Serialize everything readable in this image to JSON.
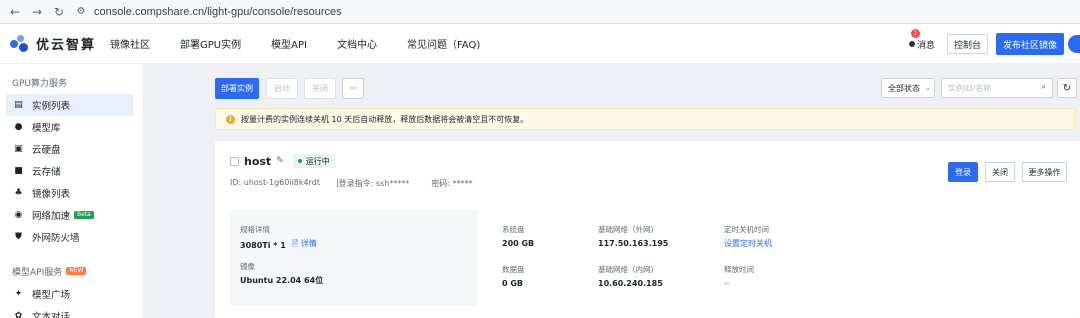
{
  "browser": {
    "url": "console.compshare.cn/light-gpu/console/resources"
  },
  "header": {
    "brand": "优云智算",
    "nav": [
      "镜像社区",
      "部署GPU实例",
      "模型API",
      "文档中心",
      "常见问题（FAQ)"
    ],
    "message_label": "消息",
    "message_count": "1",
    "console_label": "控制台",
    "publish_label": "发布社区镜像"
  },
  "sidebar": {
    "group1": "GPU算力服务",
    "items1": [
      {
        "label": "实例列表",
        "icon": "instance-list-icon"
      },
      {
        "label": "模型库",
        "icon": "model-library-icon"
      },
      {
        "label": "云硬盘",
        "icon": "cloud-disk-icon"
      },
      {
        "label": "云存储",
        "icon": "cloud-storage-icon"
      },
      {
        "label": "镜像列表",
        "icon": "image-list-icon"
      },
      {
        "label": "网络加速",
        "icon": "network-accel-icon",
        "tag": "Beta"
      },
      {
        "label": "外网防火墙",
        "icon": "firewall-icon"
      }
    ],
    "group2": "模型API服务",
    "group2_tag": "NEW",
    "items2": [
      {
        "label": "模型广场",
        "icon": "model-square-icon"
      },
      {
        "label": "文本对话",
        "icon": "text-chat-icon"
      }
    ]
  },
  "toolbar": {
    "deploy_label": "部署实例",
    "start_label": "启动",
    "shutdown_label": "关闭",
    "more_label": "···",
    "status_select": "全部状态",
    "search_placeholder": "实例ID/名称"
  },
  "notice": {
    "text": "按量计费的实例连续关机 10 天后自动释放，释放后数据将会被清空且不可恢复。"
  },
  "instance": {
    "name": "host",
    "status": "运行中",
    "id_label": "ID: uhost-1g60ii8k4rdt",
    "login_cmd": "登录指令: ssh*****",
    "password": "密码: *****",
    "login_btn": "登录",
    "close_btn": "关闭",
    "more_btn": "更多操作",
    "spec_label": "规格详情",
    "spec_value": "3080Ti * 1",
    "spec_detail_link": "详情",
    "image_label": "镜像",
    "image_value": "Ubuntu 22.04 64位",
    "sys_disk_label": "系统盘",
    "sys_disk_value": "200 GB",
    "data_disk_label": "数据盘",
    "data_disk_value": "0 GB",
    "public_net_label": "基础网络（外网)",
    "public_ip": "117.50.163.195",
    "private_net_label": "基础网络（内网)",
    "private_ip": "10.60.240.185",
    "schedule_label": "定时关机时间",
    "schedule_link": "设置定时关机",
    "release_label": "释放时间",
    "release_value": "--"
  },
  "colors": {
    "primary": "#2a6bf2",
    "running": "#1f9d55",
    "warning": "#f5a623"
  }
}
